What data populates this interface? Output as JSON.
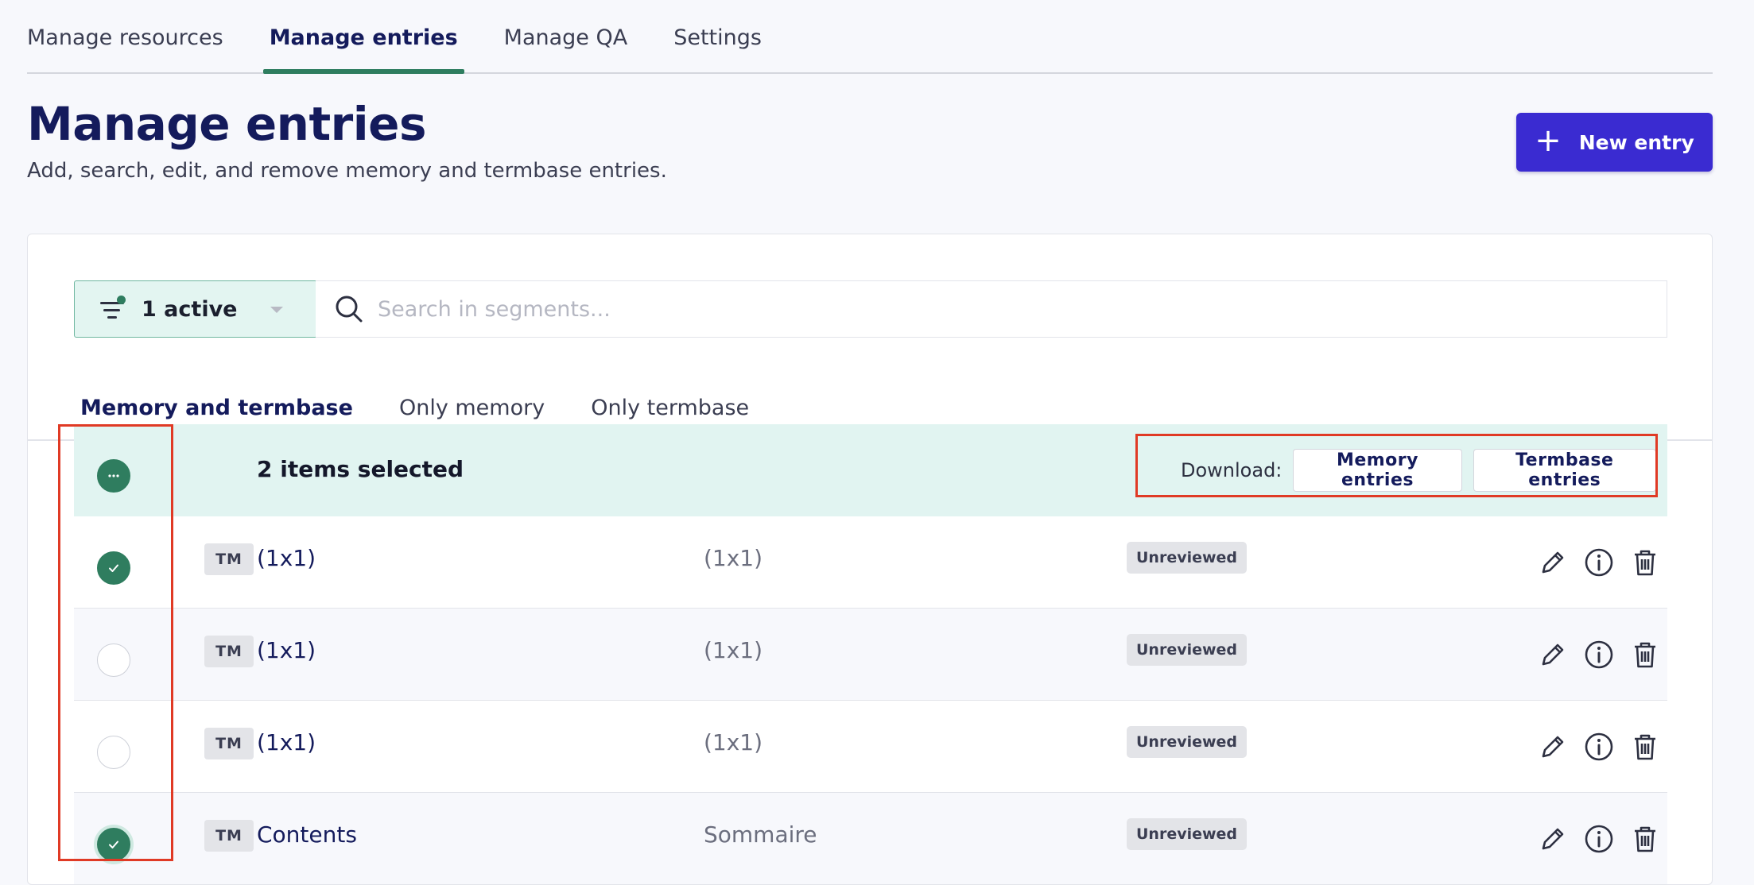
{
  "nav": {
    "tabs": [
      {
        "label": "Manage resources"
      },
      {
        "label": "Manage entries"
      },
      {
        "label": "Manage QA"
      },
      {
        "label": "Settings"
      }
    ]
  },
  "header": {
    "title": "Manage entries",
    "subtitle": "Add, search, edit, and remove memory and termbase entries.",
    "new_entry_label": "New entry"
  },
  "filter": {
    "label": "1 active"
  },
  "search": {
    "placeholder": "Search in segments..."
  },
  "subtabs": [
    {
      "label": "Memory and termbase"
    },
    {
      "label": "Only memory"
    },
    {
      "label": "Only termbase"
    }
  ],
  "selection": {
    "count_label": "2 items selected",
    "download_label": "Download:",
    "memory_button": "Memory entries",
    "termbase_button": "Termbase entries"
  },
  "rows": [
    {
      "tag": "TM",
      "source": "(1x1)",
      "target": "(1x1)",
      "status": "Unreviewed",
      "selected": true
    },
    {
      "tag": "TM",
      "source": "(1x1)",
      "target": "(1x1)",
      "status": "Unreviewed",
      "selected": false
    },
    {
      "tag": "TM",
      "source": "(1x1)",
      "target": "(1x1)",
      "status": "Unreviewed",
      "selected": false
    },
    {
      "tag": "TM",
      "source": "Contents",
      "target": "Sommaire",
      "status": "Unreviewed",
      "selected": true
    }
  ],
  "colors": {
    "accent": "#3a2bd1",
    "brand_green": "#2e7d5f",
    "selection_bg": "#e1f4f1",
    "annotation_red": "#e03a25"
  }
}
